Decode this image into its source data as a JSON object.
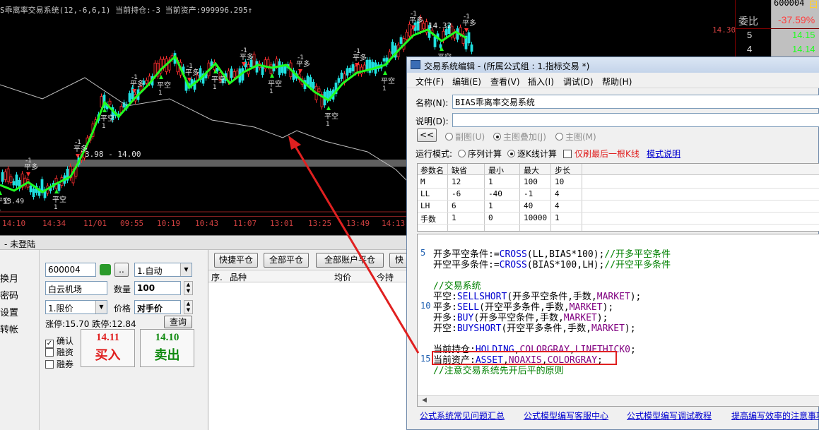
{
  "chart": {
    "title_prefix": "S乖离率交易系统(12,-6,6,1)",
    "holding_label": "当前持仓:-3",
    "asset_label": "当前资产:999996.295",
    "price_label_1": "14.32",
    "price_label_2": "14.30",
    "price_range": "3.98 - 14.00",
    "low_price": "13.49",
    "signal_labels": [
      "平空",
      "开空",
      "平多",
      "开多",
      "-1",
      "1"
    ],
    "time_axis": [
      "14:10",
      "14:34",
      "11/01",
      "09:55",
      "10:19",
      "10:43",
      "11:07",
      "13:01",
      "13:25",
      "13:49",
      "14:13"
    ],
    "colors": {
      "bg": "#000000",
      "up": "#ff3030",
      "down": "#20e0e0",
      "signal_up": "#20ff20",
      "line": "#c0c0c0"
    }
  },
  "quote": {
    "code": "600004",
    "title_char": "白",
    "weibi_label": "委比",
    "weibi_value": "-37.59%",
    "rows": [
      {
        "level": "5",
        "price": "14.15"
      },
      {
        "level": "4",
        "price": "14.14"
      }
    ]
  },
  "trade": {
    "window_title": "-  未登陆",
    "nav": [
      "换月",
      "密码",
      "设置",
      "转帐"
    ],
    "stock_code": "600004",
    "mode_select": "1.自动",
    "stock_name": "白云机场",
    "qty_label": "数量",
    "qty_value": "100",
    "order_type": "1.限价",
    "price_label": "价格",
    "price_value": "对手价",
    "limit_info": "涨停:15.70 跌停:12.84",
    "query_btn": "查询",
    "checks": [
      {
        "label": "确认",
        "checked": true
      },
      {
        "label": "融资",
        "checked": false
      },
      {
        "label": "融券",
        "checked": false
      }
    ],
    "buy": {
      "price": "14.11",
      "label": "买入"
    },
    "sell": {
      "price": "14.10",
      "label": "卖出"
    },
    "more_btn": "..",
    "toolbar": [
      "快捷平仓",
      "全部平仓",
      "全部账户平仓",
      "快"
    ],
    "columns": [
      "序.",
      "品种",
      "均价",
      "今持"
    ]
  },
  "dialog": {
    "title": "交易系统编辑 - (所属公式组 : 1.指标交易 *)",
    "menu": [
      "文件(F)",
      "编辑(E)",
      "查看(V)",
      "插入(I)",
      "调试(D)",
      "帮助(H)"
    ],
    "name_label": "名称(N):",
    "name_value": "BIAS乖离率交易系统",
    "desc_label": "说明(D):",
    "desc_value": "",
    "collapse_btn": "<<",
    "chart_modes": [
      {
        "label": "副图(U)",
        "on": false
      },
      {
        "label": "主图叠加(J)",
        "on": true
      },
      {
        "label": "主图(M)",
        "on": false
      }
    ],
    "run_mode_label": "运行模式:",
    "run_modes": [
      {
        "label": "序列计算",
        "on": false
      },
      {
        "label": "逐K线计算",
        "on": true
      }
    ],
    "refresh_last": "仅刷最后一根K线",
    "mode_help": "模式说明",
    "param_headers": [
      "参数名",
      "缺省",
      "最小",
      "最大",
      "步长"
    ],
    "params": [
      [
        "M",
        "12",
        "1",
        "100",
        "10"
      ],
      [
        "LL",
        "-6",
        "-40",
        "-1",
        "4"
      ],
      [
        "LH",
        "6",
        "1",
        "40",
        "4"
      ],
      [
        "手数",
        "1",
        "0",
        "10000",
        "1"
      ]
    ],
    "line_numbers": [
      "5",
      "10",
      "15"
    ],
    "links": [
      "公式系统常见问题汇总",
      "公式模型编写客服中心",
      "公式模型编写调试教程",
      "提高编写效率的注意事项"
    ]
  }
}
